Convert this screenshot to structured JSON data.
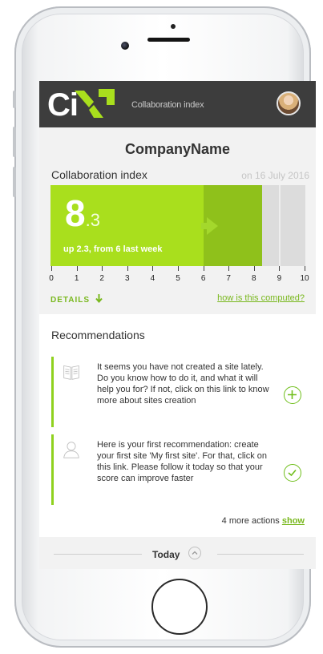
{
  "app": {
    "logo_text": "Ci",
    "header_title": "Collaboration index"
  },
  "company": {
    "name": "CompanyName"
  },
  "collab_index": {
    "title": "Collaboration index",
    "date": "on 16 July 2016",
    "score_int": "8",
    "score_dec": ".3",
    "score_value": 8.3,
    "previous_value": 6,
    "subtitle": "up 2.3, from 6 last week",
    "scale_max": 10,
    "ticks": [
      "0",
      "1",
      "2",
      "3",
      "4",
      "5",
      "6",
      "7",
      "8",
      "9",
      "10"
    ],
    "details_label": "DETAILS",
    "computed_link": "how is this computed?"
  },
  "recommendations": {
    "title": "Recommendations",
    "items": [
      {
        "icon": "book-icon",
        "text": "It seems you have not created a site lately. Do you know how to do it, and what it will help you for? If not, click on this link to know more about sites creation",
        "action_icon": "plus-circle-icon"
      },
      {
        "icon": "user-icon",
        "text": "Here is your first recommendation: create your first site 'My first site'. For that, click on this link. Please follow it today so that your score can improve faster",
        "action_icon": "check-circle-icon"
      }
    ],
    "more_text": "4 more actions",
    "more_link": "show"
  },
  "timeline": {
    "label": "Today"
  },
  "colors": {
    "accent": "#a9df1d",
    "accent_dark": "#8fc11b",
    "link": "#79b81e",
    "header": "#3d3d3d"
  }
}
